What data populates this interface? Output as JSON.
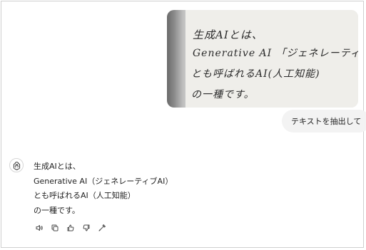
{
  "user_message": {
    "image": {
      "handwritten_lines": [
        "生成AIとは、",
        "Generative AI 「ジェネレーティブAI」",
        "とも呼ばれるAI(人工知能)",
        "の一種です。"
      ]
    },
    "prompt": "テキストを抽出して"
  },
  "assistant_message": {
    "avatar_icon": "openai-logo-icon",
    "lines": [
      "生成AIとは、",
      "Generative AI（ジェネレーティブAI）",
      "とも呼ばれるAI（人工知能）",
      "の一種です。"
    ],
    "actions": [
      {
        "icon": "speaker-icon"
      },
      {
        "icon": "copy-icon"
      },
      {
        "icon": "thumbs-up-icon"
      },
      {
        "icon": "thumbs-down-icon"
      },
      {
        "icon": "regenerate-icon"
      }
    ]
  }
}
